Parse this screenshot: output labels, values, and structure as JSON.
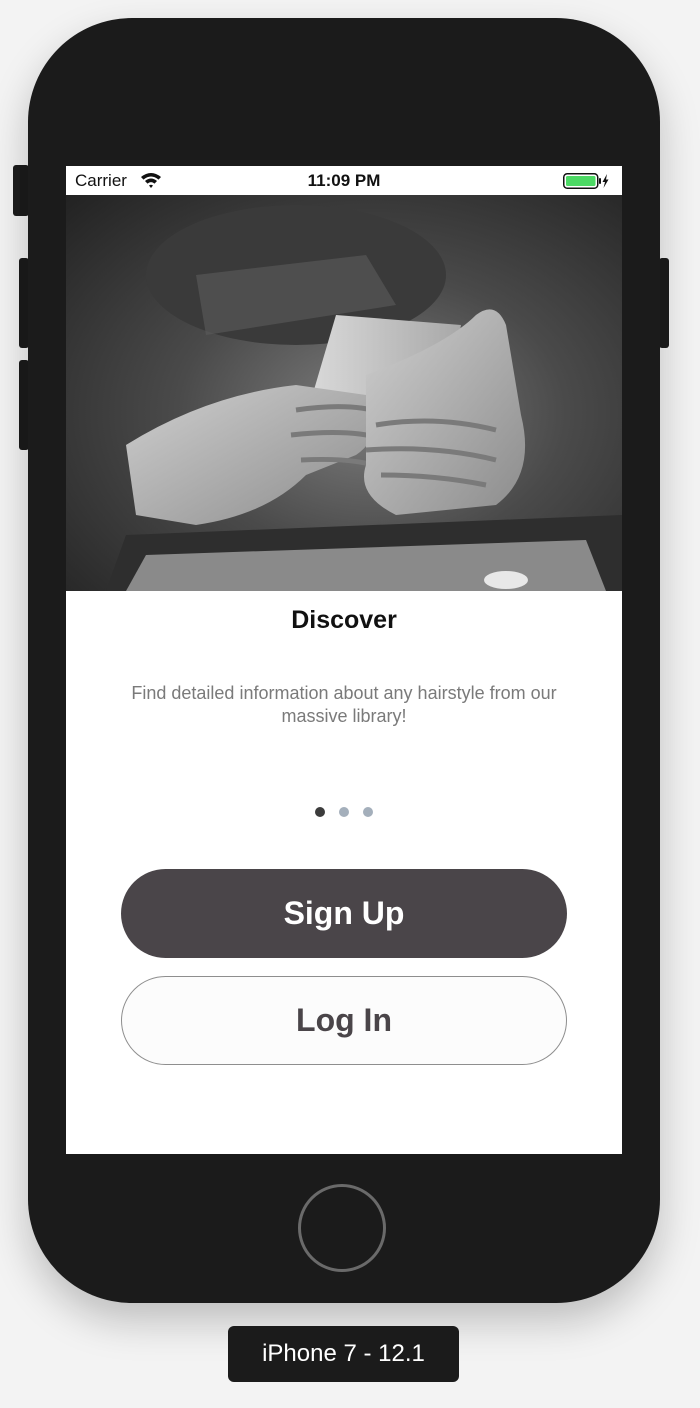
{
  "status_bar": {
    "carrier": "Carrier",
    "time": "11:09 PM",
    "wifi_icon": "wifi-icon",
    "battery_icon": "battery-charging-icon",
    "battery_color": "#4cd964"
  },
  "onboarding": {
    "image": "hands-holding-phone-photo",
    "title": "Discover",
    "description": "Find detailed information about any hairstyle from our massive library!",
    "page_count": 3,
    "current_page": 1
  },
  "actions": {
    "signup_label": "Sign Up",
    "login_label": "Log In"
  },
  "simulator": {
    "device_label": "iPhone 7 - 12.1"
  },
  "colors": {
    "primary_button": "#4a4549",
    "secondary_button_bg": "#fcfcfc",
    "dot_active": "#3c3c3c",
    "dot_inactive": "#a4afbb"
  }
}
